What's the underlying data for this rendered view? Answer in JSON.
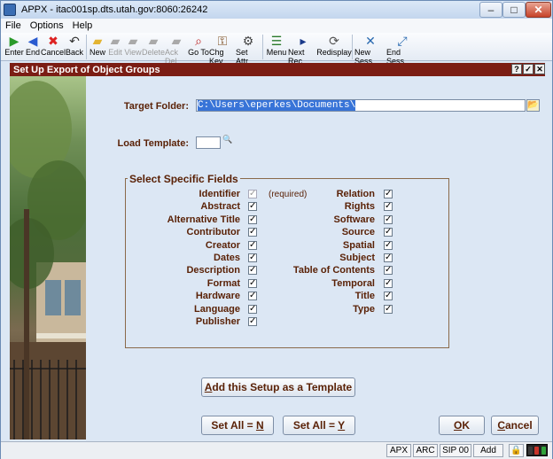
{
  "window": {
    "title": "APPX - itac001sp.dts.utah.gov:8060:26242"
  },
  "menu": [
    "File",
    "Options",
    "Help"
  ],
  "toolbar": [
    {
      "label": "Enter",
      "icon": "play-icon",
      "enabled": true
    },
    {
      "label": "End",
      "icon": "back-arrow-icon",
      "enabled": true
    },
    {
      "label": "Cancel",
      "icon": "cancel-icon",
      "enabled": true
    },
    {
      "label": "Back",
      "icon": "back-icon",
      "enabled": true
    },
    {
      "label": "New",
      "icon": "new-folder-icon",
      "enabled": true
    },
    {
      "label": "Edit",
      "icon": "edit-folder-icon",
      "enabled": false
    },
    {
      "label": "View",
      "icon": "view-folder-icon",
      "enabled": false
    },
    {
      "label": "Delete",
      "icon": "delete-folder-icon",
      "enabled": false
    },
    {
      "label": "Ack Del",
      "icon": "ack-delete-icon",
      "enabled": false
    },
    {
      "label": "Go To",
      "icon": "magnifier-icon",
      "enabled": true
    },
    {
      "label": "Chg Key",
      "icon": "key-icon",
      "enabled": true
    },
    {
      "label": "Set Attr",
      "icon": "set-attr-icon",
      "enabled": true
    },
    {
      "label": "Menu",
      "icon": "menu-icon",
      "enabled": true
    },
    {
      "label": "Next Rec",
      "icon": "next-record-icon",
      "enabled": true
    },
    {
      "label": "Redisplay",
      "icon": "redisplay-icon",
      "enabled": true
    },
    {
      "label": "New Sess",
      "icon": "new-session-icon",
      "enabled": true
    },
    {
      "label": "End Sess",
      "icon": "end-session-icon",
      "enabled": true
    }
  ],
  "header": {
    "title": "Set Up Export of Object Groups",
    "buttons": [
      "?",
      "✓",
      "✕"
    ]
  },
  "form": {
    "target_folder_label": "Target Folder:",
    "target_folder_value": "C:\\Users\\eperkes\\Documents\\",
    "load_template_label": "Load Template:",
    "load_template_value": "",
    "fields_legend": "Select Specific Fields",
    "required_note": "(required)",
    "left_fields": [
      {
        "label": "Identifier",
        "checked": true,
        "disabled": true
      },
      {
        "label": "Abstract",
        "checked": true
      },
      {
        "label": "Alternative Title",
        "checked": true
      },
      {
        "label": "Contributor",
        "checked": true
      },
      {
        "label": "Creator",
        "checked": true
      },
      {
        "label": "Dates",
        "checked": true
      },
      {
        "label": "Description",
        "checked": true
      },
      {
        "label": "Format",
        "checked": true
      },
      {
        "label": "Hardware",
        "checked": true
      },
      {
        "label": "Language",
        "checked": true
      },
      {
        "label": "Publisher",
        "checked": true
      }
    ],
    "right_fields": [
      {
        "label": "Relation",
        "checked": true
      },
      {
        "label": "Rights",
        "checked": true
      },
      {
        "label": "Software",
        "checked": true
      },
      {
        "label": "Source",
        "checked": true
      },
      {
        "label": "Spatial",
        "checked": true
      },
      {
        "label": "Subject",
        "checked": true
      },
      {
        "label": "Table of Contents",
        "checked": true
      },
      {
        "label": "Temporal",
        "checked": true
      },
      {
        "label": "Title",
        "checked": true
      },
      {
        "label": "Type",
        "checked": true
      }
    ],
    "add_template_button": {
      "pre": "",
      "key": "A",
      "post": "dd this Setup as a Template"
    },
    "set_all_n_button": {
      "pre": "Set All = ",
      "key": "N",
      "post": ""
    },
    "set_all_y_button": {
      "pre": "Set All = ",
      "key": "Y",
      "post": ""
    },
    "ok_button": {
      "pre": "",
      "key": "O",
      "post": "K"
    },
    "cancel_button": {
      "pre": "",
      "key": "C",
      "post": "ancel"
    }
  },
  "status": {
    "cells": [
      "APX",
      "ARC",
      "SIP 00",
      "Add"
    ],
    "lights": [
      "#3a3a3a",
      "#c8342a",
      "#2fa23a"
    ]
  }
}
